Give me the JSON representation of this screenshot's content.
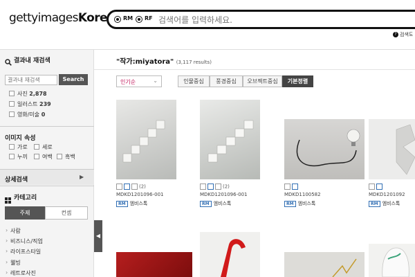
{
  "header": {
    "logo_light": "gettyimages",
    "logo_bold": "Korea",
    "logo_mark": "®",
    "radio_rm": "RM",
    "radio_rf": "RF",
    "search_placeholder": "검색어를 입력하세요.",
    "help_text": "검색도"
  },
  "sidebar": {
    "refine_title": "결과내 재검색",
    "refine_placeholder": "결과내 재검색",
    "search_button": "Search",
    "type_filters": [
      {
        "label": "사진",
        "count": "2,878"
      },
      {
        "label": "일러스트",
        "count": "239"
      },
      {
        "label": "영화/미술",
        "count": "0"
      }
    ],
    "attr_title": "이미지 속성",
    "attr_filters": [
      "가로",
      "세로",
      "누끼",
      "여백",
      "흑백"
    ],
    "advanced_title": "상세검색",
    "category_title": "카테고리",
    "category_tabs": {
      "active": "주제",
      "inactive": "컨셉"
    },
    "categories": [
      "사람",
      "비즈니스/직업",
      "라이프스타일",
      "웰빙",
      "레트로사진"
    ]
  },
  "main": {
    "query_title": "\"작가:miyatora\"",
    "results_count": "(3,117 results)",
    "sort_selected": "인기순",
    "view_tabs": [
      "인물중심",
      "풍경중심",
      "오브젝트중심",
      "기본정렬"
    ],
    "active_view": "기본정렬",
    "images": [
      {
        "code": "MDKD1201096-001",
        "rm": "엠비스톡",
        "count": "(2)"
      },
      {
        "code": "MDKD1201096-001",
        "rm": "엠비스톡",
        "count": "(2)"
      },
      {
        "code": "MDKD1100582",
        "rm": "엠비스톡",
        "count": ""
      },
      {
        "code": "MDKD1201092",
        "rm": "엠비스톡",
        "count": ""
      }
    ]
  },
  "colors": {
    "accent_pink": "#c2185b",
    "rm_blue": "#2f6db3",
    "dark_tab": "#444444"
  }
}
